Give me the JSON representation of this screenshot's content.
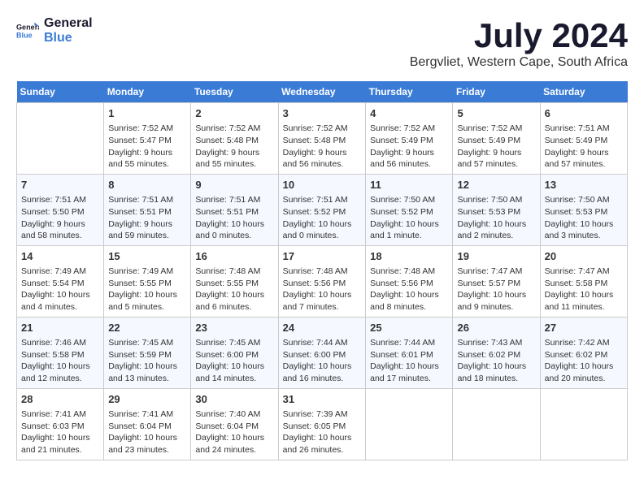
{
  "header": {
    "logo_line1": "General",
    "logo_line2": "Blue",
    "month_title": "July 2024",
    "location": "Bergvliet, Western Cape, South Africa"
  },
  "days_of_week": [
    "Sunday",
    "Monday",
    "Tuesday",
    "Wednesday",
    "Thursday",
    "Friday",
    "Saturday"
  ],
  "weeks": [
    [
      {
        "day": "",
        "info": ""
      },
      {
        "day": "1",
        "info": "Sunrise: 7:52 AM\nSunset: 5:47 PM\nDaylight: 9 hours\nand 55 minutes."
      },
      {
        "day": "2",
        "info": "Sunrise: 7:52 AM\nSunset: 5:48 PM\nDaylight: 9 hours\nand 55 minutes."
      },
      {
        "day": "3",
        "info": "Sunrise: 7:52 AM\nSunset: 5:48 PM\nDaylight: 9 hours\nand 56 minutes."
      },
      {
        "day": "4",
        "info": "Sunrise: 7:52 AM\nSunset: 5:49 PM\nDaylight: 9 hours\nand 56 minutes."
      },
      {
        "day": "5",
        "info": "Sunrise: 7:52 AM\nSunset: 5:49 PM\nDaylight: 9 hours\nand 57 minutes."
      },
      {
        "day": "6",
        "info": "Sunrise: 7:51 AM\nSunset: 5:49 PM\nDaylight: 9 hours\nand 57 minutes."
      }
    ],
    [
      {
        "day": "7",
        "info": "Sunrise: 7:51 AM\nSunset: 5:50 PM\nDaylight: 9 hours\nand 58 minutes."
      },
      {
        "day": "8",
        "info": "Sunrise: 7:51 AM\nSunset: 5:51 PM\nDaylight: 9 hours\nand 59 minutes."
      },
      {
        "day": "9",
        "info": "Sunrise: 7:51 AM\nSunset: 5:51 PM\nDaylight: 10 hours\nand 0 minutes."
      },
      {
        "day": "10",
        "info": "Sunrise: 7:51 AM\nSunset: 5:52 PM\nDaylight: 10 hours\nand 0 minutes."
      },
      {
        "day": "11",
        "info": "Sunrise: 7:50 AM\nSunset: 5:52 PM\nDaylight: 10 hours\nand 1 minute."
      },
      {
        "day": "12",
        "info": "Sunrise: 7:50 AM\nSunset: 5:53 PM\nDaylight: 10 hours\nand 2 minutes."
      },
      {
        "day": "13",
        "info": "Sunrise: 7:50 AM\nSunset: 5:53 PM\nDaylight: 10 hours\nand 3 minutes."
      }
    ],
    [
      {
        "day": "14",
        "info": "Sunrise: 7:49 AM\nSunset: 5:54 PM\nDaylight: 10 hours\nand 4 minutes."
      },
      {
        "day": "15",
        "info": "Sunrise: 7:49 AM\nSunset: 5:55 PM\nDaylight: 10 hours\nand 5 minutes."
      },
      {
        "day": "16",
        "info": "Sunrise: 7:48 AM\nSunset: 5:55 PM\nDaylight: 10 hours\nand 6 minutes."
      },
      {
        "day": "17",
        "info": "Sunrise: 7:48 AM\nSunset: 5:56 PM\nDaylight: 10 hours\nand 7 minutes."
      },
      {
        "day": "18",
        "info": "Sunrise: 7:48 AM\nSunset: 5:56 PM\nDaylight: 10 hours\nand 8 minutes."
      },
      {
        "day": "19",
        "info": "Sunrise: 7:47 AM\nSunset: 5:57 PM\nDaylight: 10 hours\nand 9 minutes."
      },
      {
        "day": "20",
        "info": "Sunrise: 7:47 AM\nSunset: 5:58 PM\nDaylight: 10 hours\nand 11 minutes."
      }
    ],
    [
      {
        "day": "21",
        "info": "Sunrise: 7:46 AM\nSunset: 5:58 PM\nDaylight: 10 hours\nand 12 minutes."
      },
      {
        "day": "22",
        "info": "Sunrise: 7:45 AM\nSunset: 5:59 PM\nDaylight: 10 hours\nand 13 minutes."
      },
      {
        "day": "23",
        "info": "Sunrise: 7:45 AM\nSunset: 6:00 PM\nDaylight: 10 hours\nand 14 minutes."
      },
      {
        "day": "24",
        "info": "Sunrise: 7:44 AM\nSunset: 6:00 PM\nDaylight: 10 hours\nand 16 minutes."
      },
      {
        "day": "25",
        "info": "Sunrise: 7:44 AM\nSunset: 6:01 PM\nDaylight: 10 hours\nand 17 minutes."
      },
      {
        "day": "26",
        "info": "Sunrise: 7:43 AM\nSunset: 6:02 PM\nDaylight: 10 hours\nand 18 minutes."
      },
      {
        "day": "27",
        "info": "Sunrise: 7:42 AM\nSunset: 6:02 PM\nDaylight: 10 hours\nand 20 minutes."
      }
    ],
    [
      {
        "day": "28",
        "info": "Sunrise: 7:41 AM\nSunset: 6:03 PM\nDaylight: 10 hours\nand 21 minutes."
      },
      {
        "day": "29",
        "info": "Sunrise: 7:41 AM\nSunset: 6:04 PM\nDaylight: 10 hours\nand 23 minutes."
      },
      {
        "day": "30",
        "info": "Sunrise: 7:40 AM\nSunset: 6:04 PM\nDaylight: 10 hours\nand 24 minutes."
      },
      {
        "day": "31",
        "info": "Sunrise: 7:39 AM\nSunset: 6:05 PM\nDaylight: 10 hours\nand 26 minutes."
      },
      {
        "day": "",
        "info": ""
      },
      {
        "day": "",
        "info": ""
      },
      {
        "day": "",
        "info": ""
      }
    ]
  ]
}
